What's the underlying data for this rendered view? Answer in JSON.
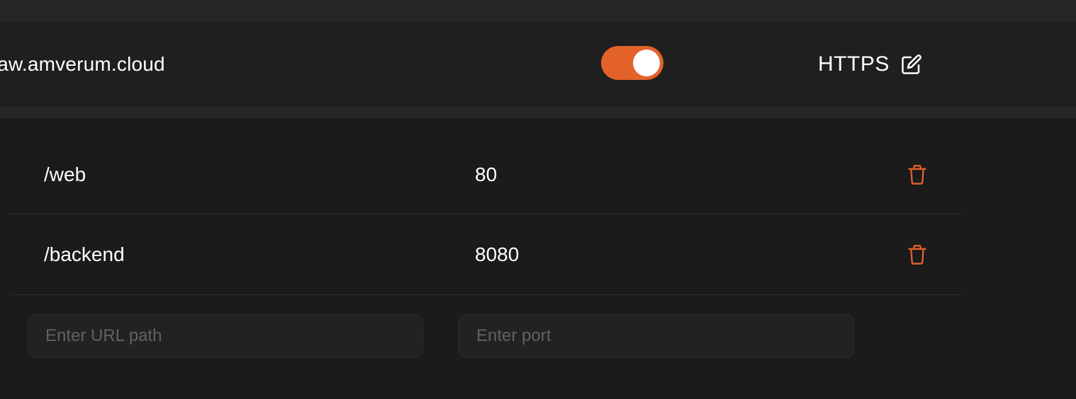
{
  "domain": {
    "host": "vaw.amverum.cloud",
    "enabled": true,
    "protocol": "HTTPS"
  },
  "routes": [
    {
      "path": "/web",
      "port": "80"
    },
    {
      "path": "/backend",
      "port": "8080"
    }
  ],
  "new_route": {
    "path_placeholder": "Enter URL path",
    "port_placeholder": "Enter port"
  },
  "colors": {
    "accent": "#e2622a",
    "background": "#1b1b1b",
    "row_background": "#1f1f1f"
  },
  "icons": {
    "edit": "edit-icon",
    "delete": "trash-icon"
  }
}
